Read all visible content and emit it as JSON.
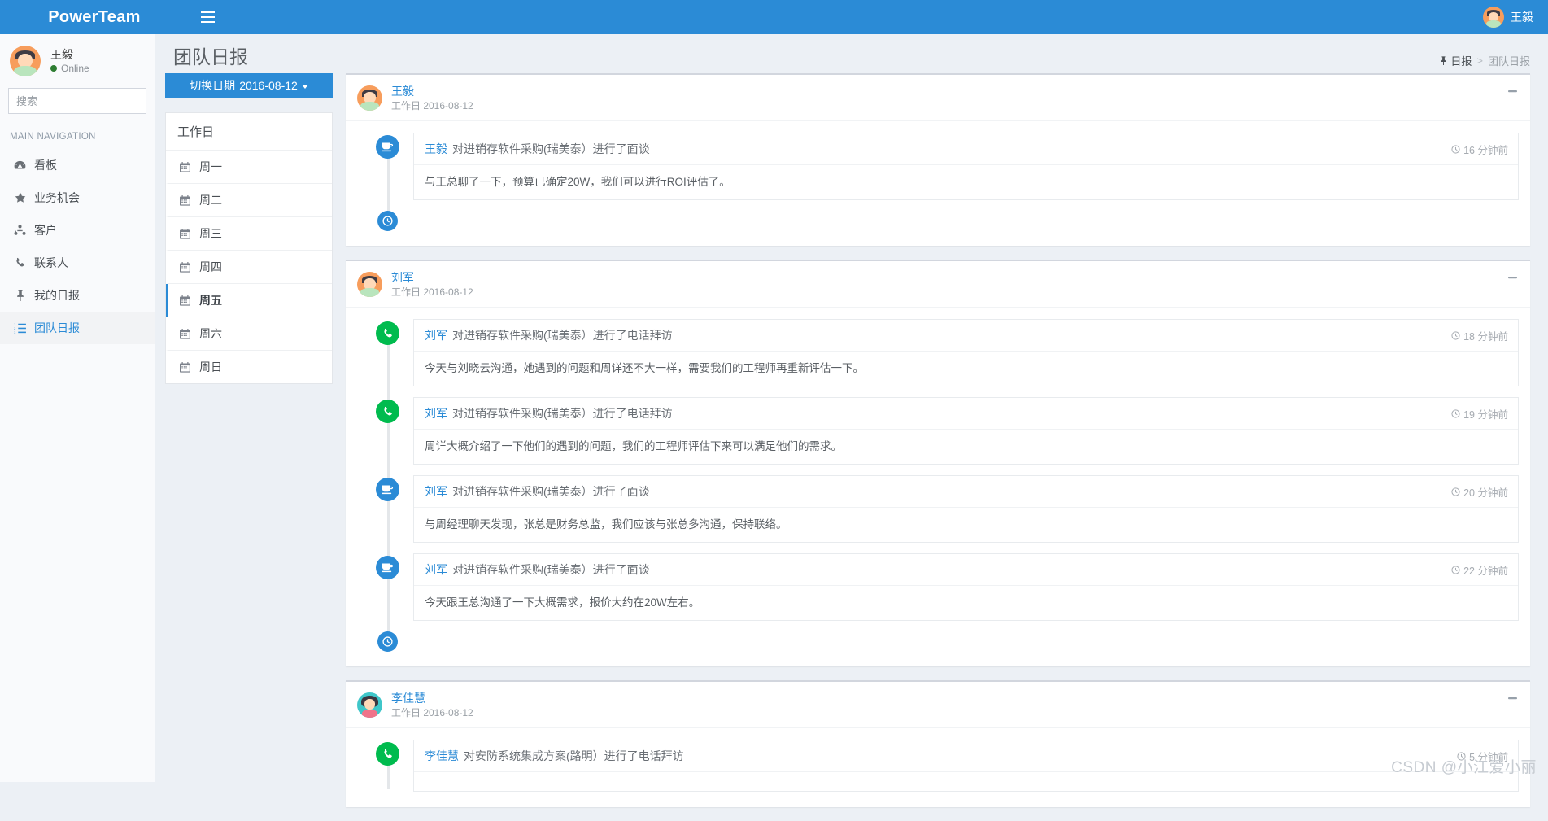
{
  "app": {
    "brand": "PowerTeam",
    "menu_icon": "hamburger-icon",
    "header_user": "王毅"
  },
  "sidebar": {
    "user": {
      "name": "王毅",
      "status": "Online"
    },
    "search": {
      "value": "",
      "placeholder": "搜索",
      "icon": "search-icon"
    },
    "nav_header": "MAIN NAVIGATION",
    "items": [
      {
        "label": "看板",
        "icon": "dashboard-icon",
        "active": false
      },
      {
        "label": "业务机会",
        "icon": "star-icon",
        "active": false
      },
      {
        "label": "客户",
        "icon": "users-icon",
        "active": false
      },
      {
        "label": "联系人",
        "icon": "phone-icon",
        "active": false
      },
      {
        "label": "我的日报",
        "icon": "pin-icon",
        "active": false
      },
      {
        "label": "团队日报",
        "icon": "list-ol-icon",
        "active": true
      }
    ]
  },
  "page": {
    "title": "团队日报",
    "breadcrumb": {
      "icon": "pin-icon",
      "root": "日报",
      "separator": ">",
      "current": "团队日报"
    }
  },
  "date_switcher": {
    "label": "切换日期",
    "date": "2016-08-12",
    "caret": "chevron-down-icon"
  },
  "weekdays": {
    "title": "工作日",
    "items": [
      {
        "label": "周一",
        "icon": "calendar-icon",
        "active": false
      },
      {
        "label": "周二",
        "icon": "calendar-icon",
        "active": false
      },
      {
        "label": "周三",
        "icon": "calendar-icon",
        "active": false
      },
      {
        "label": "周四",
        "icon": "calendar-icon",
        "active": false
      },
      {
        "label": "周五",
        "icon": "calendar-icon",
        "active": true
      },
      {
        "label": "周六",
        "icon": "calendar-icon",
        "active": false
      },
      {
        "label": "周日",
        "icon": "calendar-icon",
        "active": false
      }
    ]
  },
  "colors": {
    "brand_blue": "#2b8bd6",
    "green": "#00bb4e",
    "page_bg": "#ecf0f5",
    "muted": "#9aa0a6"
  },
  "reports": [
    {
      "name": "王毅",
      "subtitle": "工作日 2016-08-12",
      "avatar": "avatar-orange-male",
      "collapse_icon": "minus-icon",
      "entries": [
        {
          "who": "王毅",
          "action": "对进销存软件采购(瑞美泰）进行了面谈",
          "time": "16 分钟前",
          "time_icon": "clock-icon",
          "icon": "coffee-icon",
          "icon_color": "blue",
          "text": "与王总聊了一下，预算已确定20W，我们可以进行ROI评估了。"
        }
      ],
      "end_icon": "clock-icon"
    },
    {
      "name": "刘军",
      "subtitle": "工作日 2016-08-12",
      "avatar": "avatar-orange-male",
      "collapse_icon": "minus-icon",
      "entries": [
        {
          "who": "刘军",
          "action": "对进销存软件采购(瑞美泰）进行了电话拜访",
          "time": "18 分钟前",
          "time_icon": "clock-icon",
          "icon": "phone-icon",
          "icon_color": "green",
          "text": "今天与刘晓云沟通，她遇到的问题和周详还不大一样，需要我们的工程师再重新评估一下。"
        },
        {
          "who": "刘军",
          "action": "对进销存软件采购(瑞美泰）进行了电话拜访",
          "time": "19 分钟前",
          "time_icon": "clock-icon",
          "icon": "phone-icon",
          "icon_color": "green",
          "text": "周详大概介绍了一下他们的遇到的问题，我们的工程师评估下来可以满足他们的需求。"
        },
        {
          "who": "刘军",
          "action": "对进销存软件采购(瑞美泰）进行了面谈",
          "time": "20 分钟前",
          "time_icon": "clock-icon",
          "icon": "coffee-icon",
          "icon_color": "blue",
          "text": "与周经理聊天发现，张总是财务总监，我们应该与张总多沟通，保持联络。"
        },
        {
          "who": "刘军",
          "action": "对进销存软件采购(瑞美泰）进行了面谈",
          "time": "22 分钟前",
          "time_icon": "clock-icon",
          "icon": "coffee-icon",
          "icon_color": "blue",
          "text": "今天跟王总沟通了一下大概需求，报价大约在20W左右。"
        }
      ],
      "end_icon": "clock-icon"
    },
    {
      "name": "李佳慧",
      "subtitle": "工作日 2016-08-12",
      "avatar": "avatar-teal-female",
      "collapse_icon": "minus-icon",
      "entries": [
        {
          "who": "李佳慧",
          "action": "对安防系统集成方案(路明）进行了电话拜访",
          "time": "5 分钟前",
          "time_icon": "clock-icon",
          "icon": "phone-icon",
          "icon_color": "green",
          "text": ""
        }
      ],
      "end_icon": "clock-icon"
    }
  ],
  "watermark": "CSDN @小江爱小丽"
}
